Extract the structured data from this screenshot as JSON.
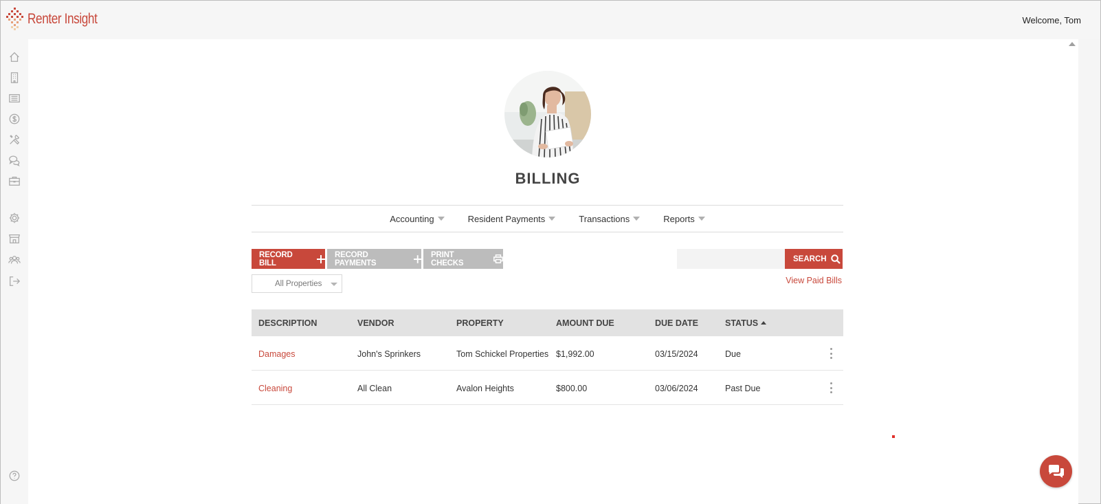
{
  "app": {
    "logo_text": "Renter Insight",
    "welcome_text": "Welcome, Tom",
    "brand_color": "#c8483b"
  },
  "sidebar": {
    "items": [
      {
        "icon": "home-icon"
      },
      {
        "icon": "building-icon"
      },
      {
        "icon": "list-icon"
      },
      {
        "icon": "dollar-icon"
      },
      {
        "icon": "tools-icon"
      },
      {
        "icon": "chat-bubbles-icon"
      },
      {
        "icon": "briefcase-icon"
      },
      {
        "icon": "gear-icon"
      },
      {
        "icon": "store-icon"
      },
      {
        "icon": "users-icon"
      },
      {
        "icon": "logout-icon"
      },
      {
        "icon": "help-icon"
      }
    ]
  },
  "page": {
    "title": "BILLING"
  },
  "subnav": {
    "items": [
      "Accounting",
      "Resident Payments",
      "Transactions",
      "Reports"
    ]
  },
  "toolbar": {
    "record_bill": "RECORD BILL",
    "record_payments": "RECORD PAYMENTS",
    "print_checks": "PRINT CHECKS",
    "search_label": "SEARCH",
    "search_placeholder": "",
    "view_paid_bills": "View Paid Bills",
    "property_filter": "All Properties"
  },
  "table": {
    "columns": [
      "DESCRIPTION",
      "VENDOR",
      "PROPERTY",
      "AMOUNT DUE",
      "DUE DATE",
      "STATUS"
    ],
    "sorted_column": "STATUS",
    "sort_direction": "ascending",
    "rows": [
      {
        "description": "Damages",
        "vendor": "John's Sprinkers",
        "property": "Tom Schickel Properties",
        "amount_due": "$1,992.00",
        "due_date": "03/15/2024",
        "status": "Due"
      },
      {
        "description": "Cleaning",
        "vendor": "All Clean",
        "property": "Avalon Heights",
        "amount_due": "$800.00",
        "due_date": "03/06/2024",
        "status": "Past Due"
      }
    ]
  },
  "chat": {
    "icon": "chat-icon"
  }
}
